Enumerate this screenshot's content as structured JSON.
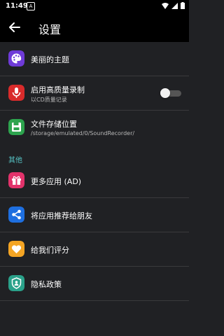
{
  "status_bar": {
    "time": "11:49",
    "notification_icon": "A"
  },
  "app_bar": {
    "title": "设置"
  },
  "settings": [
    {
      "label": "美丽的主题",
      "icon": "palette-icon"
    },
    {
      "label": "启用高质量录制",
      "sublabel": "以CD质量记录",
      "icon": "microphone-icon",
      "toggle_on": false
    },
    {
      "label": "文件存储位置",
      "sublabel": "/storage/emulated/0/SoundRecorder/",
      "icon": "save-icon"
    }
  ],
  "other_section": {
    "title": "其他",
    "items": [
      {
        "label": "更多应用 (AD)",
        "icon": "gift-icon"
      },
      {
        "label": "将应用推荐给朋友",
        "icon": "share-icon"
      },
      {
        "label": "给我们评分",
        "icon": "heart-icon"
      },
      {
        "label": "隐私政策",
        "icon": "privacy-shield-icon"
      }
    ]
  },
  "colors": {
    "background": "#202124",
    "accent_section": "#57c6c7",
    "palette_icon_bg": "#6f3bd8",
    "microphone_icon_bg": "#d92b2b",
    "save_icon_bg": "#2da44e",
    "gift_icon_bg": "#e2336b",
    "share_icon_bg": "#1e6fe0",
    "heart_icon_bg": "#f4a524",
    "privacy_icon_bg": "#2aa18a"
  }
}
